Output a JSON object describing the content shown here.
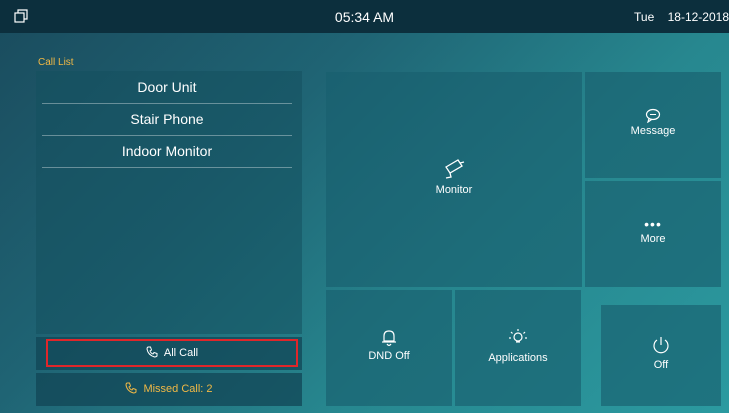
{
  "topbar": {
    "time": "05:34 AM",
    "day": "Tue",
    "date": "18-12-2018"
  },
  "call_list": {
    "title": "Call List",
    "items": [
      {
        "label": "Door Unit"
      },
      {
        "label": "Stair Phone"
      },
      {
        "label": "Indoor Monitor"
      }
    ],
    "all_call_label": "All Call",
    "missed_call_label": "Missed Call: 2"
  },
  "tiles": {
    "monitor": "Monitor",
    "message": "Message",
    "more": "More",
    "dnd": "DND Off",
    "applications": "Applications",
    "off": "Off"
  },
  "icons": {
    "home": "home-icon",
    "monitor": "camera-icon",
    "message": "chat-bubble-icon",
    "more": "more-dots-icon",
    "dnd": "bell-icon",
    "applications": "lightbulb-icon",
    "off": "power-icon",
    "call": "phone-icon"
  },
  "colors": {
    "accent": "#f2b945",
    "highlight": "#e0262a",
    "topbar": "#0c2f3d"
  }
}
